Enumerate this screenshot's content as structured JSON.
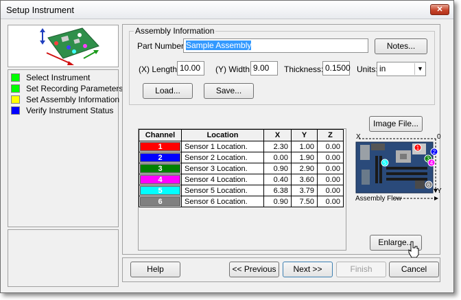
{
  "window": {
    "title": "Setup Instrument",
    "close_label": "✕"
  },
  "steps": [
    {
      "label": "Select Instrument",
      "color": "#00ff00"
    },
    {
      "label": "Set Recording Parameters",
      "color": "#00ff00"
    },
    {
      "label": "Set Assembly Information",
      "color": "#ffff00"
    },
    {
      "label": "Verify Instrument Status",
      "color": "#0000ff"
    }
  ],
  "assembly": {
    "group_title": "Assembly Information",
    "part_number_label": "Part Number:",
    "part_number_value": "Sample Assembly",
    "notes_button": "Notes...",
    "length_label": "(X) Length:",
    "length_value": "10.00",
    "width_label": "(Y) Width:",
    "width_value": "9.00",
    "thickness_label": "Thickness:",
    "thickness_value": "0.1500",
    "units_label": "Units:",
    "units_value": "in",
    "load_button": "Load...",
    "save_button": "Save..."
  },
  "table": {
    "headers": [
      "Channel",
      "Location",
      "X",
      "Y",
      "Z"
    ],
    "rows": [
      {
        "channel": "1",
        "color": "#ff0000",
        "location": "Sensor 1 Location.",
        "x": "2.30",
        "y": "1.00",
        "z": "0.00"
      },
      {
        "channel": "2",
        "color": "#0000ff",
        "location": "Sensor 2 Location.",
        "x": "0.00",
        "y": "1.90",
        "z": "0.00"
      },
      {
        "channel": "3",
        "color": "#008000",
        "location": "Sensor 3 Location.",
        "x": "0.90",
        "y": "2.90",
        "z": "0.00"
      },
      {
        "channel": "4",
        "color": "#ff00ff",
        "location": "Sensor 4 Location.",
        "x": "0.40",
        "y": "3.60",
        "z": "0.00"
      },
      {
        "channel": "5",
        "color": "#00ffff",
        "location": "Sensor 5 Location.",
        "x": "6.38",
        "y": "3.79",
        "z": "0.00"
      },
      {
        "channel": "6",
        "color": "#808080",
        "location": "Sensor 6 Location.",
        "x": "0.90",
        "y": "7.50",
        "z": "0.00"
      }
    ]
  },
  "preview": {
    "image_file_button": "Image File...",
    "x_axis_label": "X",
    "y_axis_label": "Y",
    "origin_label": "0",
    "flow_label": "Assembly Flow",
    "enlarge_button": "Enlarge...",
    "markers": [
      "1",
      "2",
      "3",
      "4",
      "5",
      "6"
    ]
  },
  "footer": {
    "help": "Help",
    "previous": "<< Previous",
    "next": "Next >>",
    "finish": "Finish",
    "cancel": "Cancel"
  }
}
